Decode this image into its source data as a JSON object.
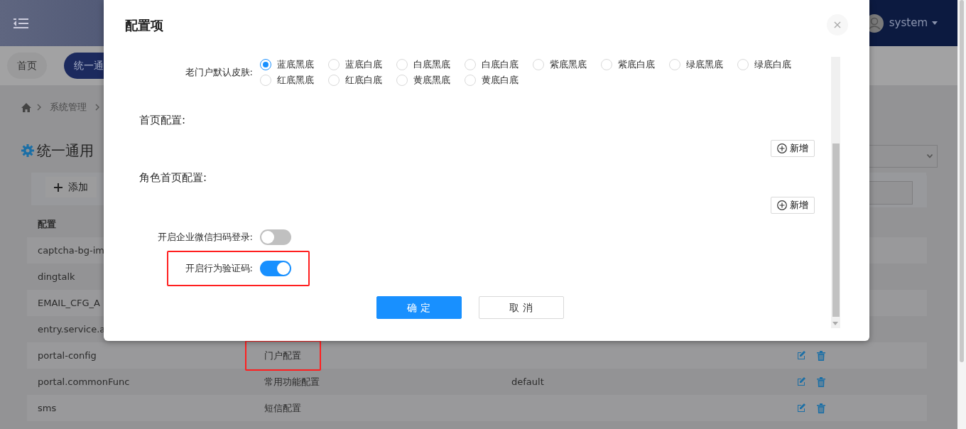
{
  "header": {
    "user": "system"
  },
  "tabs": [
    {
      "label": "首页",
      "selected": false
    },
    {
      "label": "统一通",
      "selected": true
    }
  ],
  "breadcrumb": [
    "系统管理"
  ],
  "page_title": "统一通用",
  "toolbar": {
    "add_button": "添加"
  },
  "table": {
    "columns": [
      "配置"
    ],
    "rows": [
      {
        "name": "captcha-bg-im",
        "highlighted": false
      },
      {
        "name": "dingtalk",
        "highlighted": false
      },
      {
        "name": "EMAIL_CFG_A",
        "highlighted": false
      },
      {
        "name": "entry.service.a",
        "highlighted": false
      },
      {
        "name": "portal-config",
        "description": "门户配置",
        "actions": true,
        "highlighted": true
      },
      {
        "name": "portal.commonFunc",
        "description": "常用功能配置",
        "value": "default",
        "actions": true,
        "highlighted": false
      },
      {
        "name": "sms",
        "description": "短信配置",
        "actions": true,
        "highlighted": false
      }
    ]
  },
  "modal": {
    "title": "配置项",
    "close": "×",
    "fields": [
      {
        "kind": "radio_group",
        "label": "老门户默认皮肤:",
        "options": [
          {
            "label": "蓝底黑底",
            "selected": true
          },
          {
            "label": "蓝底白底",
            "selected": false
          },
          {
            "label": "白底黑底",
            "selected": false
          },
          {
            "label": "白底白底",
            "selected": false
          },
          {
            "label": "紫底黑底",
            "selected": false
          },
          {
            "label": "紫底白底",
            "selected": false
          },
          {
            "label": "绿底黑底",
            "selected": false
          },
          {
            "label": "绿底白底",
            "selected": false
          },
          {
            "label": "红底黑底",
            "selected": false
          },
          {
            "label": "红底白底",
            "selected": false
          },
          {
            "label": "黄底黑底",
            "selected": false
          },
          {
            "label": "黄底白底",
            "selected": false
          }
        ]
      },
      {
        "kind": "list",
        "label": "首页配置:",
        "button": "新增"
      },
      {
        "kind": "list",
        "label": "角色首页配置:",
        "button": "新增"
      },
      {
        "kind": "switch",
        "label": "开启企业微信扫码登录:",
        "on": false,
        "highlighted": false
      },
      {
        "kind": "switch",
        "label": "开启行为验证码:",
        "on": true,
        "highlighted": true
      }
    ],
    "buttons": [
      {
        "label": "确 定",
        "kind": "primary"
      },
      {
        "label": "取 消",
        "kind": "default"
      }
    ]
  }
}
